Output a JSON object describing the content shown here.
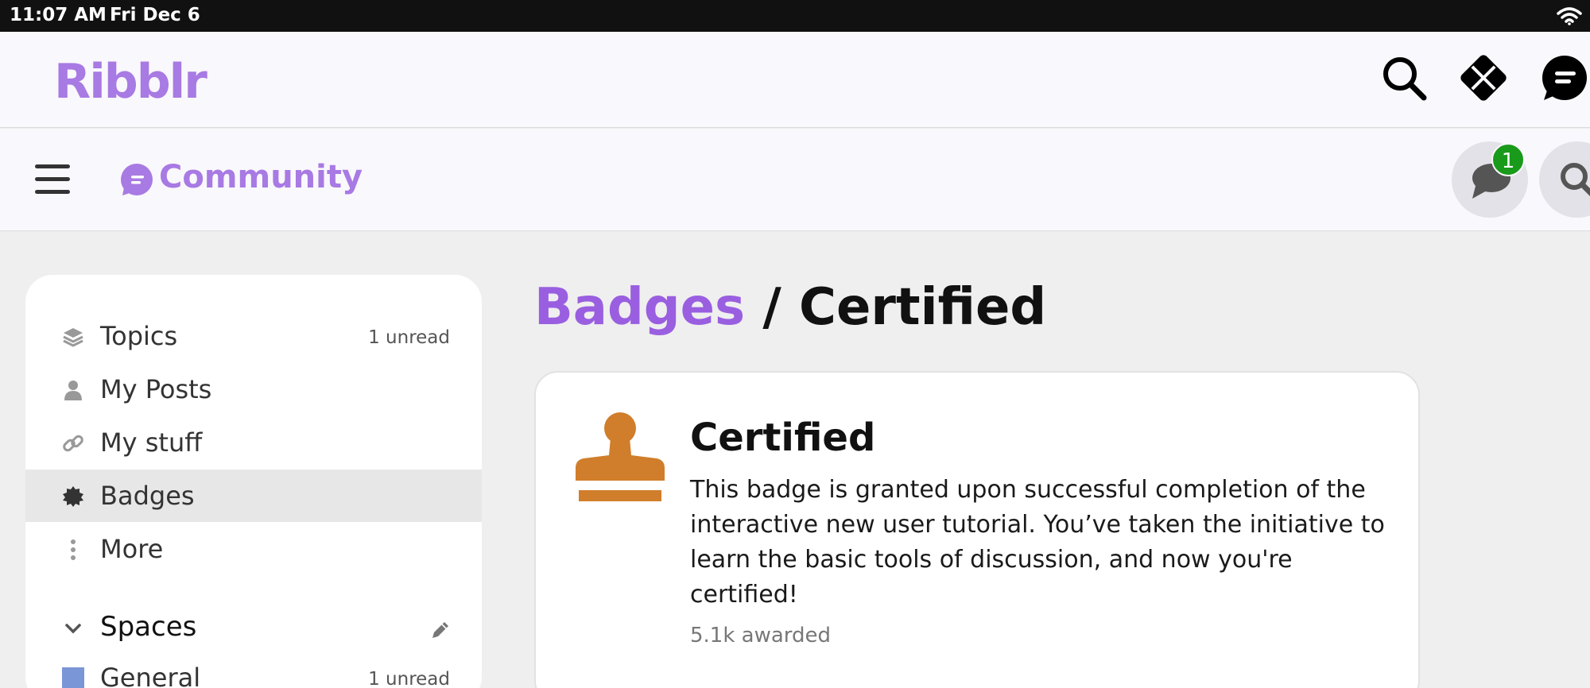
{
  "status_bar": {
    "time": "11:07 AM",
    "date": "Fri Dec 6"
  },
  "app_header": {
    "logo_text": "Ribblr",
    "icons": [
      "search-icon",
      "ribblr-app-icon",
      "community-chat-icon"
    ]
  },
  "community_bar": {
    "label": "Community",
    "notification_count": "1",
    "icons": [
      "hamburger-menu-icon",
      "chat-bubble-icon",
      "search-icon"
    ]
  },
  "sidebar": {
    "items": [
      {
        "label": "Topics",
        "meta": "1 unread",
        "icon": "stack-layers-icon"
      },
      {
        "label": "My Posts",
        "meta": "",
        "icon": "person-icon"
      },
      {
        "label": "My stuff",
        "meta": "",
        "icon": "link-icon"
      },
      {
        "label": "Badges",
        "meta": "",
        "icon": "badge-certificate-icon",
        "active": true
      },
      {
        "label": "More",
        "meta": "",
        "icon": "vertical-ellipsis-icon"
      }
    ],
    "spaces": {
      "label": "Spaces",
      "items": [
        {
          "label": "General",
          "meta": "1 unread",
          "color": "#7b96d6"
        }
      ]
    }
  },
  "main": {
    "breadcrumb_link": "Badges",
    "separator": " / ",
    "page_title": "Certified",
    "badge_card": {
      "title": "Certified",
      "description": "This badge is granted upon successful completion of the interactive new user tutorial. You’ve taken the initiative to learn the basic tools of discussion, and now you're certified!",
      "awarded": "5.1k awarded",
      "icon": "stamp-icon",
      "icon_color": "#d07e2b"
    }
  },
  "colors": {
    "brand_purple": "#a87ae3",
    "breadcrumb_purple": "#9a5fe0",
    "notification_green": "#1a9a1a"
  }
}
